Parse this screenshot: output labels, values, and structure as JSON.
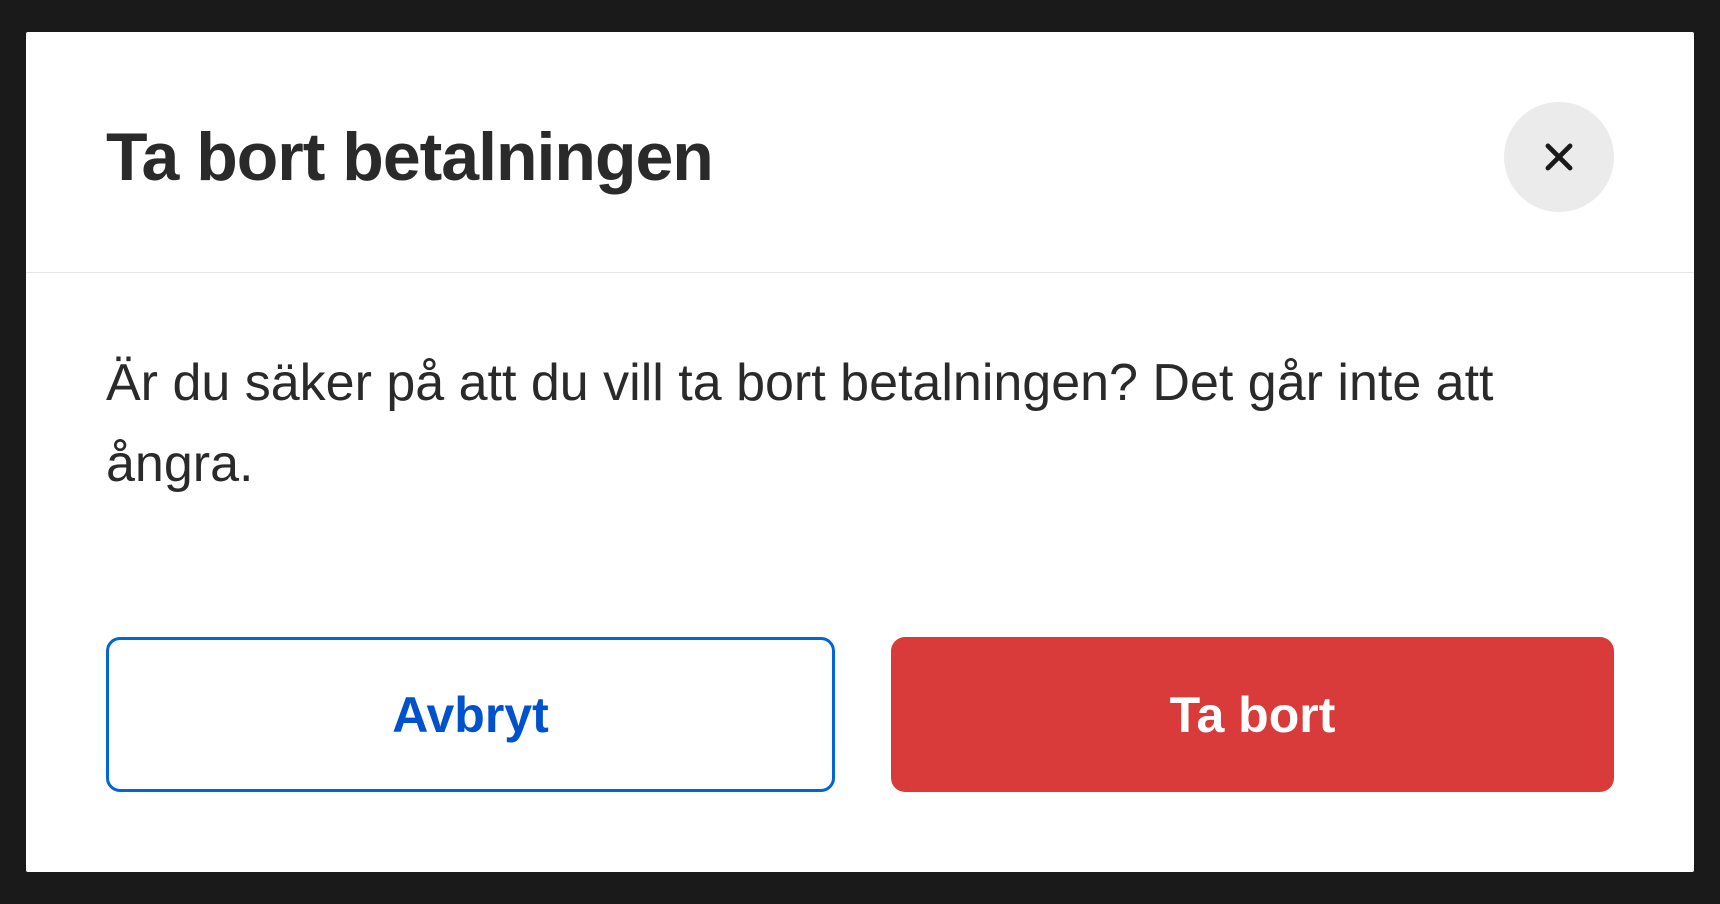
{
  "modal": {
    "title": "Ta bort betalningen",
    "message": "Är du säker på att du vill ta bort betalningen? Det går inte att ångra.",
    "buttons": {
      "cancel": "Avbryt",
      "confirm": "Ta bort"
    }
  }
}
